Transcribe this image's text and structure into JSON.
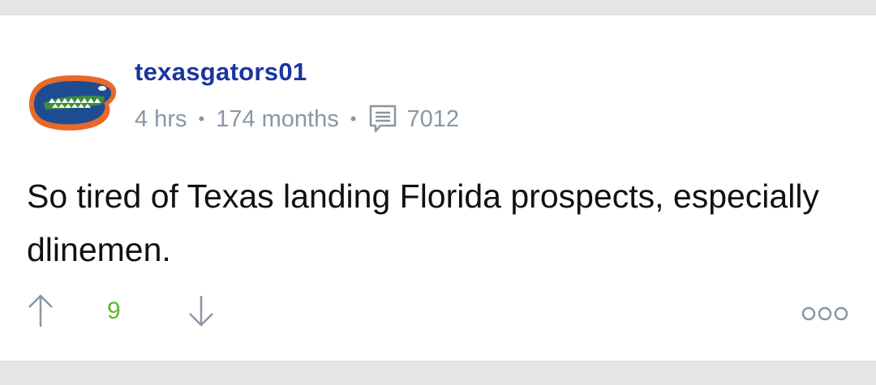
{
  "post": {
    "username": "texasgators01",
    "time_ago": "4 hrs",
    "membership": "174 months",
    "comment_count": "7012",
    "body": "So tired of Texas landing Florida prospects, especially dlinemen.",
    "score": "9"
  },
  "icons": {
    "avatar": "florida-gator-logo",
    "comment": "comment-icon",
    "upvote": "arrow-up-icon",
    "downvote": "arrow-down-icon",
    "more": "more-options-icon"
  },
  "colors": {
    "username": "#1a35a0",
    "meta": "#8a96a3",
    "score": "#5cb82a",
    "text": "#111111"
  }
}
